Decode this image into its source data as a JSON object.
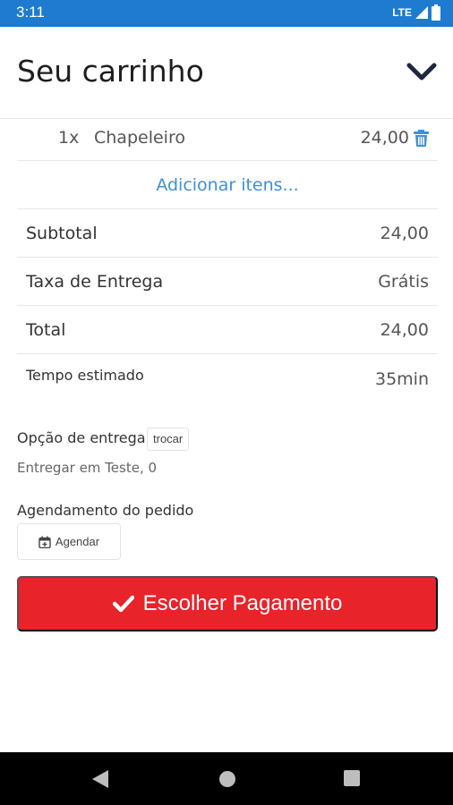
{
  "status_bar": {
    "time": "3:11",
    "network": "LTE"
  },
  "header": {
    "title": "Seu carrinho"
  },
  "cart": {
    "items": [
      {
        "qty": "1x",
        "name": "Chapeleiro",
        "price": "24,00"
      }
    ],
    "add_items_label": "Adicionar itens..."
  },
  "summary": {
    "subtotal_label": "Subtotal",
    "subtotal_value": "24,00",
    "delivery_fee_label": "Taxa de Entrega",
    "delivery_fee_value": "Grátis",
    "total_label": "Total",
    "total_value": "24,00",
    "estimated_time_label": "Tempo estimado",
    "estimated_time_value": "35min"
  },
  "delivery": {
    "label": "Opção de entrega",
    "change_label": "trocar",
    "address": "Entregar em Teste, 0"
  },
  "schedule": {
    "label": "Agendamento do pedido",
    "button_label": "Agendar"
  },
  "payment": {
    "button_label": "Escolher Pagamento"
  },
  "colors": {
    "status_bar": "#1e7bd0",
    "primary_button": "#e8232a",
    "link": "#3f90d9"
  }
}
